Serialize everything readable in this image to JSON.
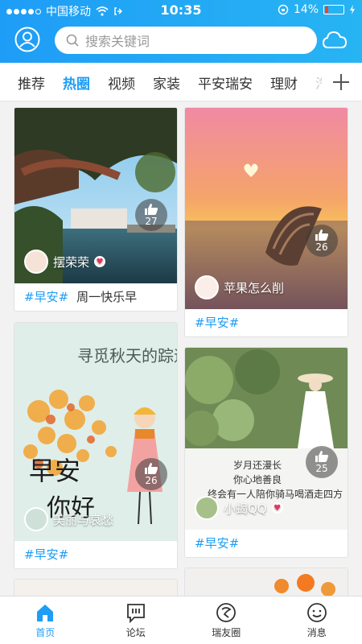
{
  "status_bar": {
    "carrier": "中国移动",
    "time": "10:35",
    "battery": "14%"
  },
  "search": {
    "placeholder": "搜索关键词"
  },
  "tabs": [
    "推荐",
    "热圈",
    "视频",
    "家装",
    "平安瑞安",
    "理财",
    "汽"
  ],
  "active_tab": "热圈",
  "cards": [
    {
      "likes": "27",
      "user": "摆荣荣",
      "tag": "#早安#",
      "text": "周一快乐早"
    },
    {
      "likes": "26",
      "user": "苹果怎么削",
      "tag": "#早安#",
      "text": ""
    },
    {
      "likes": "26",
      "user": "美丽与哀愁",
      "tag": "#早安#",
      "text": "",
      "image_title": "寻觅秋天的踪迹",
      "image_text": "早安 你好"
    },
    {
      "likes": "25",
      "user": "小蝎QQ",
      "tag": "#早安#",
      "text": "",
      "image_lines": [
        "岁月还漫长",
        "你心地善良",
        "终会有一人陪你骑马喝酒走四方"
      ]
    }
  ],
  "bottom_nav": [
    {
      "label": "首页",
      "icon": "home-icon",
      "active": true
    },
    {
      "label": "论坛",
      "icon": "forum-icon",
      "active": false
    },
    {
      "label": "瑞友圈",
      "icon": "friends-circle-icon",
      "active": false
    },
    {
      "label": "消息",
      "icon": "message-icon",
      "active": false
    }
  ],
  "colors": {
    "accent": "#1e9df6",
    "heart": "#e8335c"
  }
}
